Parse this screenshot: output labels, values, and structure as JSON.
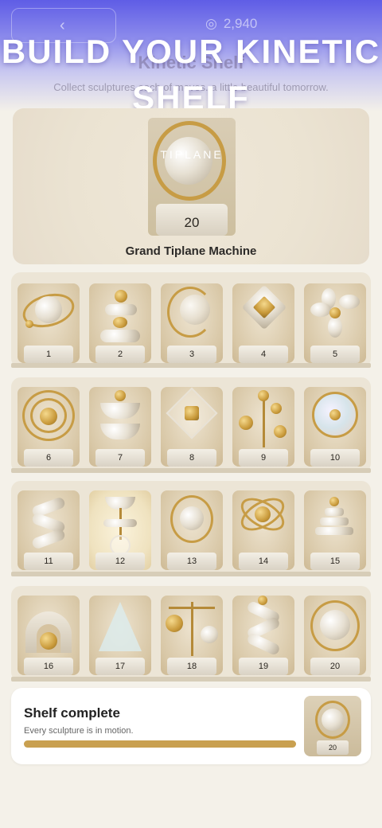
{
  "header": {
    "back_icon": "chevron-left-icon",
    "back_glyph": "‹",
    "coins_value": "2,940",
    "coin_glyph": "◎",
    "title": "Kinetic Shelf",
    "subtitle": "Collect sculptures each of moves. a little beautiful tomorrow.",
    "banner": "BUILD YOUR KINETIC SHELF"
  },
  "featured": {
    "badge": "TIPLANE",
    "number": "20",
    "name": "Grand Tiplane Machine"
  },
  "shelves": [
    {
      "items": [
        "1",
        "2",
        "3",
        "4",
        "5"
      ]
    },
    {
      "items": [
        "6",
        "7",
        "8",
        "9",
        "10"
      ]
    },
    {
      "items": [
        "11",
        "12",
        "13",
        "14",
        "15"
      ]
    },
    {
      "items": [
        "16",
        "17",
        "18",
        "19",
        "20"
      ]
    }
  ],
  "summary": {
    "title": "Shelf complete",
    "subtitle": "Every sculpture is in motion.",
    "progress": 1.0,
    "thumb_number": "20"
  },
  "colors": {
    "accent": "#c9a050",
    "header": "#5f5de6",
    "background": "#f4f1e9"
  }
}
